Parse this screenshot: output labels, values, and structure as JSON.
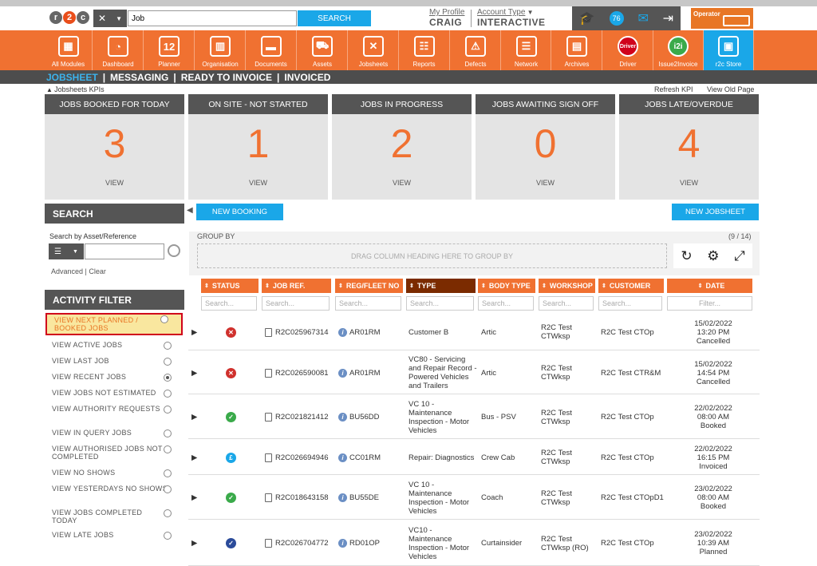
{
  "header": {
    "logo_letters": [
      "r",
      "2",
      "c"
    ],
    "search_value": "Job",
    "search_button": "SEARCH",
    "profile_link": "My Profile",
    "profile_name": "CRAIG",
    "account_link": "Account Type",
    "account_value": "INTERACTIVE",
    "notification_count": "76",
    "operator_label": "Operator"
  },
  "nav": {
    "items": [
      {
        "label": "All Modules",
        "icon": "grid-icon"
      },
      {
        "label": "Dashboard",
        "icon": "gauge-icon"
      },
      {
        "label": "Planner",
        "icon": "calendar-icon",
        "glyph": "12"
      },
      {
        "label": "Organisation",
        "icon": "buildings-icon"
      },
      {
        "label": "Documents",
        "icon": "folder-icon"
      },
      {
        "label": "Assets",
        "icon": "truck-icon"
      },
      {
        "label": "Jobsheets",
        "icon": "tools-icon"
      },
      {
        "label": "Reports",
        "icon": "clipboard-icon"
      },
      {
        "label": "Defects",
        "icon": "warning-icon"
      },
      {
        "label": "Network",
        "icon": "contact-book-icon"
      },
      {
        "label": "Archives",
        "icon": "archive-icon"
      },
      {
        "label": "Driver",
        "icon": "driver-icon",
        "glyph": "Driver"
      },
      {
        "label": "Issue2Invoice",
        "icon": "i2i-icon",
        "glyph": "i2i"
      },
      {
        "label": "r2c Store",
        "icon": "briefcase-icon"
      }
    ]
  },
  "subnav": {
    "tabs": [
      "JOBSHEET",
      "MESSAGING",
      "READY TO INVOICE",
      "INVOICED"
    ],
    "separator": "|"
  },
  "kpi_bar": {
    "toggle": "Jobsheets KPIs",
    "refresh": "Refresh KPI",
    "old_page": "View Old Page"
  },
  "kpis": [
    {
      "title": "JOBS BOOKED FOR TODAY",
      "value": "3",
      "view": "VIEW"
    },
    {
      "title": "ON SITE - NOT STARTED",
      "value": "1",
      "view": "VIEW"
    },
    {
      "title": "JOBS IN PROGRESS",
      "value": "2",
      "view": "VIEW"
    },
    {
      "title": "JOBS AWAITING SIGN OFF",
      "value": "0",
      "view": "VIEW"
    },
    {
      "title": "JOBS LATE/OVERDUE",
      "value": "4",
      "view": "VIEW"
    }
  ],
  "search_panel": {
    "title": "SEARCH",
    "label": "Search by Asset/Reference",
    "advanced": "Advanced",
    "clear": "Clear",
    "sep": "|"
  },
  "activity_filter": {
    "title": "ACTIVITY FILTER",
    "items": [
      {
        "label": "VIEW NEXT PLANNED / BOOKED JOBS",
        "selected": false,
        "highlight": true
      },
      {
        "label": "VIEW ACTIVE JOBS",
        "selected": false
      },
      {
        "label": "VIEW LAST JOB",
        "selected": false
      },
      {
        "label": "VIEW RECENT JOBS",
        "selected": true
      },
      {
        "label": "VIEW JOBS NOT ESTIMATED",
        "selected": false
      },
      {
        "label": "VIEW AUTHORITY REQUESTS",
        "selected": false
      },
      {
        "label": "VIEW IN QUERY JOBS",
        "selected": false
      },
      {
        "label": "VIEW AUTHORISED JOBS NOT COMPLETED",
        "selected": false
      },
      {
        "label": "VIEW NO SHOWS",
        "selected": false
      },
      {
        "label": "VIEW YESTERDAYS NO SHOWS",
        "selected": false
      },
      {
        "label": "VIEW JOBS COMPLETED TODAY",
        "selected": false
      },
      {
        "label": "VIEW LATE JOBS",
        "selected": false
      }
    ]
  },
  "grid": {
    "new_booking": "NEW BOOKING",
    "new_jobsheet": "NEW JOBSHEET",
    "group_by": "GROUP BY",
    "count": "(9 / 14)",
    "drag_hint": "DRAG COLUMN HEADING HERE TO GROUP BY",
    "columns": [
      "STATUS",
      "JOB REF.",
      "REG/FLEET NO",
      "TYPE",
      "BODY TYPE",
      "WORKSHOP",
      "CUSTOMER",
      "DATE"
    ],
    "filter_placeholder": "Search...",
    "date_filter_placeholder": "Filter...",
    "rows": [
      {
        "status": "cancelled",
        "status_color": "#d0312d",
        "job_ref": "R2C025967314",
        "reg": "AR01RM",
        "type": "Customer B",
        "body": "Artic",
        "workshop": "R2C Test CTWksp",
        "customer": "R2C Test CTOp",
        "date": "15/02/2022",
        "time": "13:20 PM",
        "state": "Cancelled"
      },
      {
        "status": "cancelled",
        "status_color": "#d0312d",
        "job_ref": "R2C026590081",
        "reg": "AR01RM",
        "type": "VC80 - Servicing and Repair Record - Powered Vehicles and Trailers",
        "body": "Artic",
        "workshop": "R2C Test CTWksp",
        "customer": "R2C Test CTR&M",
        "date": "15/02/2022",
        "time": "14:54 PM",
        "state": "Cancelled"
      },
      {
        "status": "booked",
        "status_color": "#3aaa4a",
        "job_ref": "R2C021821412",
        "reg": "BU56DD",
        "type": "VC 10 - Inspection - Motor Vehicles",
        "body": "Bus - PSV",
        "workshop": "R2C Test CTWksp",
        "customer": "R2C Test CTOp",
        "date": "22/02/2022",
        "time": "08:00 AM",
        "state": "Booked"
      },
      {
        "status": "invoiced",
        "status_color": "#1aa7e8",
        "job_ref": "R2C026694946",
        "reg": "CC01RM",
        "type": "Repair: Diagnostics",
        "body": "Crew Cab",
        "workshop": "R2C Test CTWksp",
        "customer": "R2C Test CTOp",
        "date": "22/02/2022",
        "time": "16:15 PM",
        "state": "Invoiced"
      },
      {
        "status": "booked",
        "status_color": "#3aaa4a",
        "job_ref": "R2C018643158",
        "reg": "BU55DE",
        "type": "VC 10 - Inspection - Motor Vehicles",
        "body": "Coach",
        "workshop": "R2C Test CTWksp",
        "customer": "R2C Test CTOpD1",
        "date": "23/02/2022",
        "time": "08:00 AM",
        "state": "Booked"
      },
      {
        "status": "planned",
        "status_color": "#2b4b9a",
        "job_ref": "R2C026704772",
        "reg": "RD01OP",
        "type": "VC10 - Maintenance Inspection - Motor Vehicles",
        "body": "Curtainsider",
        "workshop": "R2C Test CTWksp (RO)",
        "customer": "R2C Test CTOp",
        "date": "23/02/2022",
        "time": "10:39 AM",
        "state": "Planned"
      }
    ]
  },
  "types_full": [
    "Customer B",
    "VC80 - Servicing and Repair Record - Powered Vehicles and Trailers",
    "VC 10 - Maintenance Inspection - Motor Vehicles",
    "Repair: Diagnostics",
    "VC 10 - Maintenance Inspection - Motor Vehicles",
    "VC10 - Maintenance Inspection - Motor Vehicles"
  ],
  "colors": {
    "accent": "#f07131",
    "blue": "#1aa7e8",
    "dark": "#555555"
  }
}
